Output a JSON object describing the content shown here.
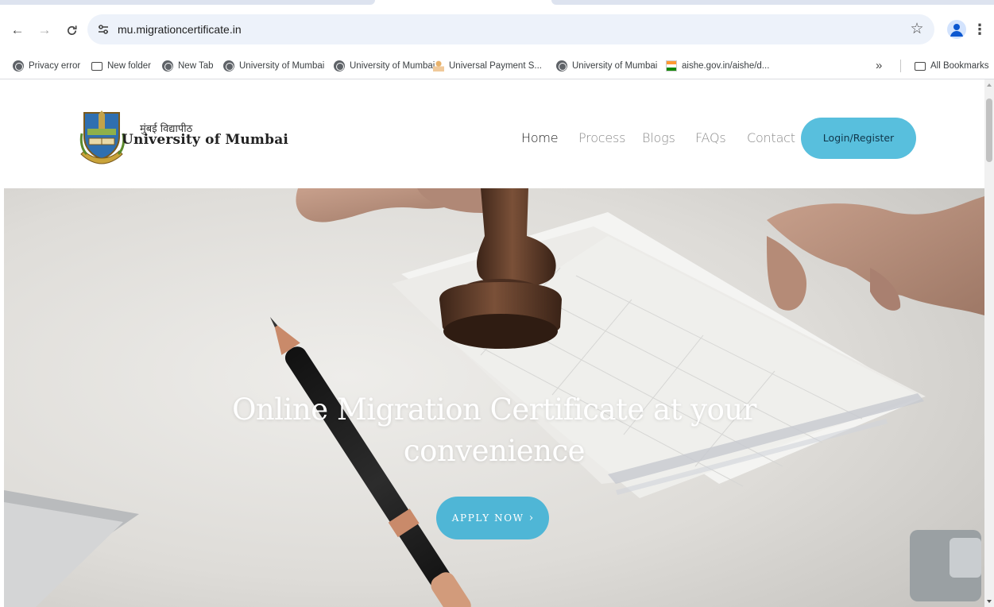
{
  "browser": {
    "url": "mu.migrationcertificate.in",
    "icons": {
      "back": "arrow-left-icon",
      "forward": "arrow-right-icon",
      "reload": "reload-icon",
      "site_info": "tune-icon",
      "bookmark": "star-icon",
      "profile": "profile-icon",
      "menu": "kebab-menu-icon"
    },
    "bookmarks": [
      {
        "label": "Privacy error",
        "icon": "globe-icon"
      },
      {
        "label": "New folder",
        "icon": "folder-icon"
      },
      {
        "label": "New Tab",
        "icon": "globe-icon"
      },
      {
        "label": "University of Mumbai",
        "icon": "globe-icon"
      },
      {
        "label": "University of Mumbai",
        "icon": "globe-icon"
      },
      {
        "label": "Universal Payment S...",
        "icon": "person-icon"
      },
      {
        "label": "University of Mumbai",
        "icon": "globe-icon"
      },
      {
        "label": "aishe.gov.in/aishe/d...",
        "icon": "india-flag-icon"
      }
    ],
    "overflow": "»",
    "all_bookmarks": "All Bookmarks"
  },
  "site": {
    "logo": {
      "hindi": "मुंबई विद्यापीठ",
      "english": "University of Mumbai"
    },
    "nav": [
      {
        "label": "Home",
        "active": true
      },
      {
        "label": "Process",
        "active": false
      },
      {
        "label": "Blogs",
        "active": false
      },
      {
        "label": "FAQs",
        "active": false
      },
      {
        "label": "Contact",
        "active": false
      }
    ],
    "login_label": "Login/Register",
    "accent_color": "#58bfdd"
  },
  "hero": {
    "title": "Online Migration Certificate at your convenience",
    "cta_label": "APPLY NOW",
    "cta_arrow": "›"
  }
}
